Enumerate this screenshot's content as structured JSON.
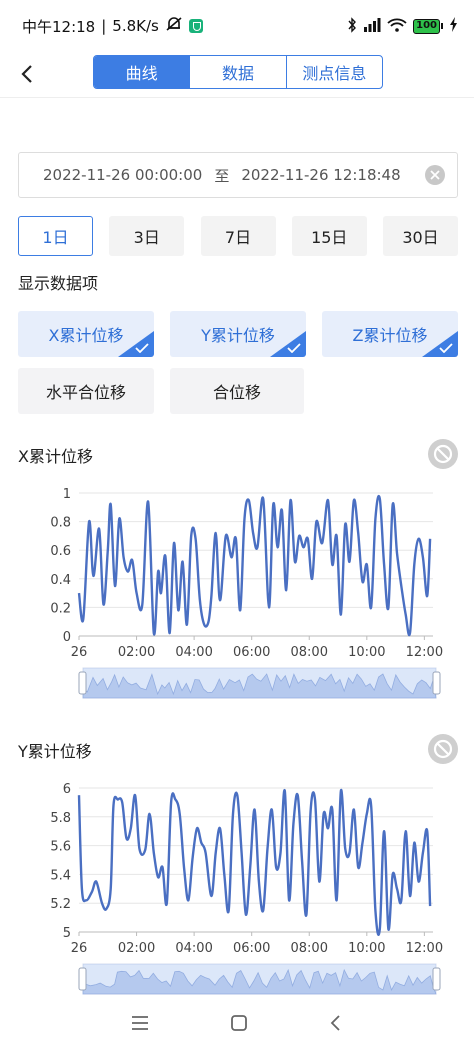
{
  "status": {
    "time": "中午12:18",
    "speed": "5.8K/s",
    "battery": "100"
  },
  "nav": {
    "tabs": [
      "曲线",
      "数据",
      "测点信息"
    ]
  },
  "date_range": {
    "start": "2022-11-26 00:00:00",
    "separator": "至",
    "end": "2022-11-26 12:18:48"
  },
  "ranges": [
    "1日",
    "3日",
    "7日",
    "15日",
    "30日"
  ],
  "display_label": "显示数据项",
  "items": [
    {
      "label": "X累计位移",
      "selected": true
    },
    {
      "label": "Y累计位移",
      "selected": true
    },
    {
      "label": "Z累计位移",
      "selected": true
    },
    {
      "label": "水平合位移",
      "selected": false
    },
    {
      "label": "合位移",
      "selected": false
    }
  ],
  "colors": {
    "accent": "#3d7de3",
    "line": "#4a6fc2"
  },
  "chart_data": [
    {
      "type": "line",
      "title": "X累计位移",
      "x_ticks": [
        "26",
        "02:00",
        "04:00",
        "06:00",
        "08:00",
        "10:00",
        "12:00"
      ],
      "y_ticks": [
        "0",
        "0.2",
        "0.4",
        "0.6",
        "0.8",
        "1"
      ],
      "ylim": [
        0,
        1
      ],
      "xlim": [
        0,
        12.3
      ],
      "grid": true,
      "x": [
        0,
        0.15,
        0.35,
        0.5,
        0.7,
        0.85,
        1.0,
        1.1,
        1.25,
        1.4,
        1.55,
        1.7,
        1.85,
        2.0,
        2.2,
        2.4,
        2.6,
        2.75,
        2.85,
        3.0,
        3.15,
        3.3,
        3.45,
        3.6,
        3.75,
        3.9,
        4.05,
        4.2,
        4.35,
        4.5,
        4.6,
        4.75,
        4.9,
        5.1,
        5.3,
        5.45,
        5.6,
        5.75,
        5.9,
        6.05,
        6.2,
        6.4,
        6.6,
        6.75,
        6.9,
        7.05,
        7.2,
        7.35,
        7.5,
        7.65,
        7.8,
        7.95,
        8.1,
        8.25,
        8.45,
        8.65,
        8.8,
        8.95,
        9.1,
        9.25,
        9.4,
        9.55,
        9.7,
        9.85,
        10.0,
        10.15,
        10.3,
        10.45,
        10.6,
        10.75,
        10.9,
        11.05,
        11.2,
        11.35,
        11.5,
        11.65,
        11.8,
        11.95,
        12.1,
        12.2
      ],
      "values": [
        0.3,
        0.12,
        0.8,
        0.42,
        0.75,
        0.22,
        0.6,
        0.92,
        0.35,
        0.82,
        0.55,
        0.45,
        0.53,
        0.3,
        0.22,
        0.94,
        0.02,
        0.45,
        0.3,
        0.56,
        0.02,
        0.65,
        0.18,
        0.52,
        0.08,
        0.7,
        0.68,
        0.25,
        0.08,
        0.1,
        0.28,
        0.72,
        0.25,
        0.7,
        0.55,
        0.68,
        0.18,
        0.82,
        0.95,
        0.72,
        0.62,
        0.96,
        0.2,
        0.92,
        0.62,
        0.88,
        0.32,
        0.95,
        0.52,
        0.7,
        0.62,
        0.68,
        0.4,
        0.8,
        0.65,
        0.95,
        0.5,
        0.7,
        0.15,
        0.78,
        0.52,
        0.95,
        0.72,
        0.38,
        0.5,
        0.2,
        0.82,
        0.96,
        0.5,
        0.2,
        0.92,
        0.58,
        0.35,
        0.15,
        0.02,
        0.5,
        0.68,
        0.55,
        0.28,
        0.68
      ]
    },
    {
      "type": "line",
      "title": "Y累计位移",
      "x_ticks": [
        "26",
        "02:00",
        "04:00",
        "06:00",
        "08:00",
        "10:00",
        "12:00"
      ],
      "y_ticks": [
        "5",
        "5.2",
        "5.4",
        "5.6",
        "5.8",
        "6"
      ],
      "ylim": [
        5,
        6
      ],
      "xlim": [
        0,
        12.3
      ],
      "grid": true,
      "x": [
        0,
        0.1,
        0.25,
        0.45,
        0.6,
        0.8,
        0.95,
        1.1,
        1.2,
        1.35,
        1.5,
        1.65,
        1.8,
        1.95,
        2.1,
        2.3,
        2.45,
        2.6,
        2.75,
        2.9,
        3.05,
        3.2,
        3.35,
        3.5,
        3.65,
        3.8,
        3.95,
        4.1,
        4.25,
        4.4,
        4.6,
        4.75,
        4.9,
        5.05,
        5.2,
        5.35,
        5.5,
        5.65,
        5.8,
        5.95,
        6.1,
        6.25,
        6.4,
        6.55,
        6.7,
        6.85,
        7.0,
        7.15,
        7.3,
        7.45,
        7.6,
        7.75,
        7.9,
        8.05,
        8.2,
        8.35,
        8.5,
        8.65,
        8.8,
        8.95,
        9.1,
        9.25,
        9.4,
        9.55,
        9.7,
        9.85,
        10.0,
        10.15,
        10.3,
        10.45,
        10.6,
        10.75,
        10.9,
        11.05,
        11.2,
        11.35,
        11.5,
        11.65,
        11.8,
        11.95,
        12.1,
        12.2
      ],
      "values": [
        5.95,
        5.3,
        5.22,
        5.28,
        5.35,
        5.2,
        5.16,
        5.3,
        5.88,
        5.92,
        5.9,
        5.65,
        5.72,
        5.95,
        5.58,
        5.57,
        5.82,
        5.55,
        5.38,
        5.45,
        5.2,
        5.9,
        5.92,
        5.82,
        5.45,
        5.22,
        5.52,
        5.72,
        5.62,
        5.55,
        5.25,
        5.55,
        5.72,
        5.4,
        5.15,
        5.82,
        5.95,
        5.55,
        5.12,
        5.45,
        5.85,
        5.35,
        5.15,
        5.58,
        5.85,
        5.45,
        5.55,
        5.98,
        5.22,
        5.75,
        5.95,
        5.5,
        5.12,
        5.85,
        5.92,
        5.35,
        5.82,
        5.72,
        5.85,
        5.22,
        5.98,
        5.58,
        5.55,
        5.85,
        5.45,
        5.62,
        5.82,
        5.88,
        5.15,
        5.02,
        5.7,
        5.02,
        5.4,
        5.3,
        5.22,
        5.7,
        5.25,
        5.62,
        5.35,
        5.55,
        5.7,
        5.18
      ]
    }
  ]
}
